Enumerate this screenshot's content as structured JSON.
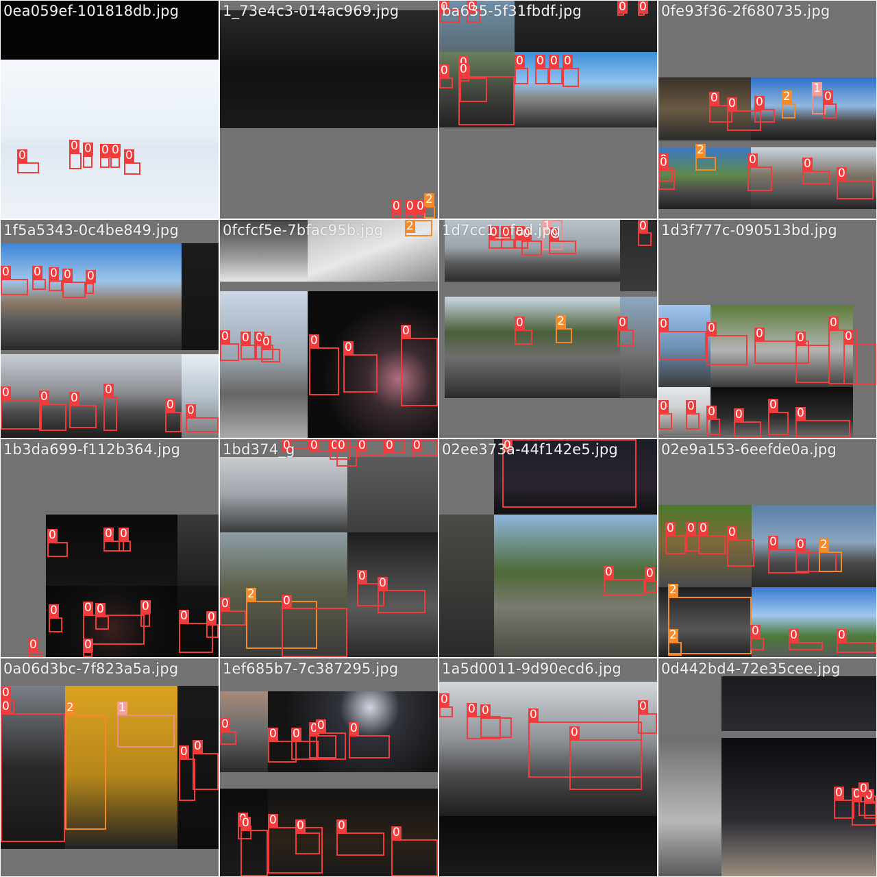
{
  "mosaic": {
    "tiles": [
      {
        "title": "0ea059ef-101818db.jpg",
        "regions": [
          {
            "bg": "#050505"
          },
          {
            "bg": "linear-gradient(180deg,#f4f8fc 0%,#e9f0f8 45%,#dfe8f2 55%,#eef3f8 100%)"
          }
        ],
        "dets": [
          {
            "cls": "0",
            "rect": {}
          },
          {
            "cls": "0",
            "rect": {}
          },
          {
            "cls": "0",
            "rect": {}
          },
          {
            "cls": "0",
            "rect": {}
          },
          {
            "cls": "0",
            "rect": {}
          },
          {
            "cls": "0",
            "rect": {}
          }
        ]
      },
      {
        "title": "1_73e4c3-014ac969.jpg",
        "regions": [
          {
            "bg": "linear-gradient(180deg,#2a2a2a 0%,#111 50%,#1a1a1a 100%)"
          }
        ],
        "dets": [
          {
            "cls": "0"
          },
          {
            "cls": "0"
          },
          {
            "cls": "0"
          },
          {
            "cls": "2"
          }
        ]
      },
      {
        "title": "ba635-5f31fbdf.jpg",
        "regions": [
          {
            "bg": "linear-gradient(180deg,#6f8ea8 0%,#5a6b75 100%)"
          },
          {
            "bg": "linear-gradient(180deg,#2a2a2a,#1c1c1c)"
          },
          {
            "bg": "linear-gradient(180deg,#6a7f5d 0%,#3c3f3a 60%,#222 100%)"
          },
          {
            "bg": "linear-gradient(180deg,#3f8fd8 0%,#8fc2ef 40%,#8a8a8a 60%,#2a2a2a 100%)"
          }
        ],
        "dets": [
          {
            "cls": "0"
          },
          {
            "cls": "0"
          },
          {
            "cls": "0"
          },
          {
            "cls": "0"
          },
          {
            "cls": "0"
          },
          {
            "cls": "0"
          },
          {
            "cls": "0"
          },
          {
            "cls": "0"
          },
          {
            "cls": "0"
          },
          {
            "cls": "0"
          },
          {
            "cls": "0"
          },
          {
            "cls": "0"
          }
        ]
      },
      {
        "title": "0fe93f36-2f680735.jpg",
        "regions": [
          {
            "bg": "linear-gradient(180deg,#3b3128 0%,#6a5a44 50%,#2b2b2b 100%)"
          },
          {
            "bg": "linear-gradient(180deg,#2f6fc9 0%,#8fb7dd 45%,#4a4a4a 70%,#1c1c1c 100%)"
          },
          {
            "bg": "linear-gradient(180deg,#3a78c8 0%,#5f8a4a 45%,#4d4d4d 70%,#1f1f1f 100%)"
          },
          {
            "bg": "linear-gradient(180deg,#c9d6e3 0%,#7d7466 45%,#5b5b5b 70%,#222 100%)"
          }
        ],
        "dets": [
          {
            "cls": "0"
          },
          {
            "cls": "0"
          },
          {
            "cls": "0"
          },
          {
            "cls": "2"
          },
          {
            "cls": "1"
          },
          {
            "cls": "0"
          },
          {
            "cls": "0"
          },
          {
            "cls": "0"
          },
          {
            "cls": "2"
          },
          {
            "cls": "0"
          },
          {
            "cls": "0"
          },
          {
            "cls": "0"
          }
        ]
      },
      {
        "title": "1f5a5343-0c4be849.jpg",
        "regions": [
          {
            "bg": "linear-gradient(180deg,#3c86d6 0%,#9ec5ea 35%,#8c7a68 55%,#555 75%,#2a2a2a 100%)"
          },
          {
            "bg": "linear-gradient(180deg,#1b1b1b,#141414)"
          },
          {
            "bg": "linear-gradient(180deg,#c9ced6 0%,#8d8f94 45%,#4a4a4a 70%,#1c1c1c 100%)"
          },
          {
            "bg": "linear-gradient(180deg,#e8eef5 0%,#b7c3cf 50%,#777 100%)"
          }
        ],
        "dets": [
          {
            "cls": "0"
          },
          {
            "cls": "0"
          },
          {
            "cls": "0"
          },
          {
            "cls": "0"
          },
          {
            "cls": "0"
          },
          {
            "cls": "0"
          },
          {
            "cls": "0"
          },
          {
            "cls": "0"
          },
          {
            "cls": "0"
          },
          {
            "cls": "0"
          },
          {
            "cls": "0"
          }
        ]
      },
      {
        "title": "0fcfcf5e-7bfac95b.jpg",
        "regions": [
          {
            "bg": "linear-gradient(180deg,#444 0%,#9a9a9a 60%,#e6e6e6 100%)"
          },
          {
            "bg": "linear-gradient(160deg,#b9b9b9 0%,#e8e8e8 50%,#8c8c8c 100%)"
          },
          {
            "bg": "linear-gradient(180deg,#c9d7e6 0%,#9aa7b2 45%,#666 70%,#aaa 100%)"
          },
          {
            "bg": "radial-gradient(circle at 70% 60%,#b07080 0%,#3a2a2e 25%,#0c0c0c 60%)"
          }
        ],
        "dets": [
          {
            "cls": "0"
          },
          {
            "cls": "0"
          },
          {
            "cls": "0"
          },
          {
            "cls": "0"
          },
          {
            "cls": "0"
          },
          {
            "cls": "0"
          },
          {
            "cls": "0"
          },
          {
            "cls": "2"
          }
        ]
      },
      {
        "title": "1d7cc1__fad.jpg",
        "regions": [
          {
            "bg": "linear-gradient(180deg,#b9c3cc 0%,#9aa3a8 45%,#5a5a5a 70%,#2c2c2c 100%)"
          },
          {
            "bg": "linear-gradient(180deg,#2a2a2a,#3a3a3a)"
          },
          {
            "bg": "linear-gradient(180deg,#c9d7e2 0%,#4b5f3a 35%,#6e6e6e 60%,#2c2c2c 100%)"
          },
          {
            "bg": "linear-gradient(180deg,#8da8c2 0%,#6e6e6e 60%,#3a3a3a 100%)"
          }
        ],
        "dets": [
          {
            "cls": "0"
          },
          {
            "cls": "0"
          },
          {
            "cls": "0"
          },
          {
            "cls": "0"
          },
          {
            "cls": "1"
          },
          {
            "cls": "0"
          },
          {
            "cls": "0"
          },
          {
            "cls": "2"
          },
          {
            "cls": "0"
          },
          {
            "cls": "0"
          }
        ]
      },
      {
        "title": "1d3f777c-090513bd.jpg",
        "regions": [
          {
            "bg": "linear-gradient(180deg,#9fc5ef 0%,#6f93b8 50%,#3a3a3a 100%)"
          },
          {
            "bg": "linear-gradient(180deg,#5e7d3a 0%,#b3b3b3 55%,#3b3b3b 100%)"
          },
          {
            "bg": "linear-gradient(180deg,#e3e9ef 0%,#cfcfcf 40%,#6a6a6a 100%)"
          },
          {
            "bg": "linear-gradient(180deg,#0d0d0d 0%,#2d2d2d 60%,#6c6c6c 100%)"
          }
        ],
        "dets": [
          {
            "cls": "0"
          },
          {
            "cls": "0"
          },
          {
            "cls": "0"
          },
          {
            "cls": "0"
          },
          {
            "cls": "0"
          },
          {
            "cls": "0"
          },
          {
            "cls": "0"
          },
          {
            "cls": "0"
          },
          {
            "cls": "0"
          },
          {
            "cls": "0"
          },
          {
            "cls": "0"
          },
          {
            "cls": "0"
          }
        ]
      },
      {
        "title": "1b3da699-f112b364.jpg",
        "regions": [
          {
            "bg": "linear-gradient(180deg,#0a0a0a,#151515)"
          },
          {
            "bg": "linear-gradient(180deg,#3a3a3a,#1e1e1e)"
          },
          {
            "bg": "radial-gradient(circle at 50% 60%,#3a2020 0%,#101010 45%,#080808 100%)"
          },
          {
            "bg": "linear-gradient(180deg,#141414,#0a0a0a)"
          }
        ],
        "dets": [
          {
            "cls": "0"
          },
          {
            "cls": "0"
          },
          {
            "cls": "0"
          },
          {
            "cls": "0"
          },
          {
            "cls": "0"
          },
          {
            "cls": "0"
          },
          {
            "cls": "0"
          },
          {
            "cls": "0"
          },
          {
            "cls": "0"
          },
          {
            "cls": "0"
          },
          {
            "cls": "0"
          }
        ]
      },
      {
        "title": "1bd374_g",
        "regions": [
          {
            "bg": "linear-gradient(180deg,#c8ccd0 0%,#9ea5ab 50%,#3a3a3a 100%)"
          },
          {
            "bg": "linear-gradient(180deg,#5b5b5b 0%,#3e3e3e 100%)"
          },
          {
            "bg": "linear-gradient(180deg,#8d9ea8 0%,#5c6048 45%,#3a3a3a 100%)"
          },
          {
            "bg": "linear-gradient(180deg,#1e1e1e 0%,#5a5a5a 60%,#2a2a2a 100%)"
          }
        ],
        "dets": [
          {
            "cls": "0"
          },
          {
            "cls": "0"
          },
          {
            "cls": "0"
          },
          {
            "cls": "0"
          },
          {
            "cls": "0"
          },
          {
            "cls": "0"
          },
          {
            "cls": "0"
          },
          {
            "cls": "2"
          },
          {
            "cls": "0"
          },
          {
            "cls": "0"
          },
          {
            "cls": "0"
          },
          {
            "cls": "0"
          }
        ]
      },
      {
        "title": "02ee373a-44f142e5.jpg",
        "regions": [
          {
            "bg": "linear-gradient(180deg,#1c1f28 0%,#2b2430 60%,#101010 100%)"
          },
          {
            "bg": "linear-gradient(180deg,#4c4a44 0%,#2a2a2a 100%)"
          },
          {
            "bg": "linear-gradient(180deg,#8fb6de 0%,#4d6b36 40%,#7a7a70 65%,#4a4a44 100%)"
          }
        ],
        "dets": [
          {
            "cls": "0"
          },
          {
            "cls": "0"
          },
          {
            "cls": "0"
          }
        ]
      },
      {
        "title": "02e9a153-6eefde0a.jpg",
        "regions": [
          {
            "bg": "linear-gradient(180deg,#4a7a2a 0%,#7d6a3a 45%,#4a4a4a 100%)"
          },
          {
            "bg": "linear-gradient(180deg,#5b7fa8 0%,#8aa5bf 45%,#4a4a4a 70%,#2a2a2a 100%)"
          },
          {
            "bg": "linear-gradient(180deg,#1f1f1f 0%,#555 60%,#222 100%)"
          },
          {
            "bg": "linear-gradient(180deg,#3a7ad0 0%,#9ec7ef 40%,#4d7a3a 70%,#5a5a5a 100%)"
          }
        ],
        "dets": [
          {
            "cls": "0"
          },
          {
            "cls": "0"
          },
          {
            "cls": "0"
          },
          {
            "cls": "0"
          },
          {
            "cls": "0"
          },
          {
            "cls": "0"
          },
          {
            "cls": "2"
          },
          {
            "cls": "2"
          },
          {
            "cls": "2"
          },
          {
            "cls": "0"
          },
          {
            "cls": "0"
          },
          {
            "cls": "0"
          }
        ]
      },
      {
        "title": "0a06d3bc-7f823a5a.jpg",
        "regions": [
          {
            "bg": "linear-gradient(180deg,#7a7f86 0%,#2a2a2a 50%,#151515 100%)"
          },
          {
            "bg": "linear-gradient(180deg,#d9a322 0%,#b7861a 55%,#222 100%)"
          },
          {
            "bg": "linear-gradient(180deg,#1a1a1a,#0d0d0d)"
          }
        ],
        "dets": [
          {
            "cls": "0"
          },
          {
            "cls": "2"
          },
          {
            "cls": "1"
          },
          {
            "cls": "0"
          },
          {
            "cls": "0"
          },
          {
            "cls": "0"
          }
        ]
      },
      {
        "title": "1ef685b7-7c387295.jpg",
        "regions": [
          {
            "bg": "linear-gradient(180deg,#a88a78 0%,#6e6e6e 45%,#2a2a2a 100%)"
          },
          {
            "bg": "radial-gradient(circle at 60% 20%,#d0d6e0 0%,#30323a 25%,#141414 70%)"
          },
          {
            "bg": "linear-gradient(180deg,#0c0c0c,#1a1a1a)"
          },
          {
            "bg": "linear-gradient(180deg,#121212 0%,#2b2218 60%,#1a1a1a 100%)"
          }
        ],
        "dets": [
          {
            "cls": "0"
          },
          {
            "cls": "0"
          },
          {
            "cls": "0"
          },
          {
            "cls": "0"
          },
          {
            "cls": "0"
          },
          {
            "cls": "0"
          },
          {
            "cls": "0"
          },
          {
            "cls": "0"
          },
          {
            "cls": "0"
          },
          {
            "cls": "0"
          },
          {
            "cls": "0"
          },
          {
            "cls": "0"
          }
        ]
      },
      {
        "title": "1a5d0011-9d90ecd6.jpg",
        "regions": [
          {
            "bg": "linear-gradient(180deg,#d3d7dc 0%,#8a8f94 45%,#4a4a4a 70%,#1e1e1e 100%)"
          },
          {
            "bg": "linear-gradient(180deg,#0a0a0a,#1a1a1a)"
          }
        ],
        "dets": [
          {
            "cls": "0"
          },
          {
            "cls": "0"
          },
          {
            "cls": "0"
          },
          {
            "cls": "0"
          },
          {
            "cls": "0"
          },
          {
            "cls": "0"
          }
        ]
      },
      {
        "title": "0d442bd4-72e35cee.jpg",
        "regions": [
          {
            "bg": "linear-gradient(180deg,#1b1b1f 0%,#2b2b30 100%)"
          },
          {
            "bg": "linear-gradient(180deg,#6f6f6f 0%,#b8b8b8 60%,#5a5a5a 100%)"
          },
          {
            "bg": "linear-gradient(180deg,#0c0c10 0%,#2d2d33 60%,#9a8f80 100%)"
          }
        ],
        "dets": [
          {
            "cls": "0"
          },
          {
            "cls": "0"
          },
          {
            "cls": "0"
          },
          {
            "cls": "0"
          }
        ]
      }
    ]
  },
  "class_colors": {
    "0": "#f03c3c",
    "1": "#f5a0a0",
    "2": "#f58a2a"
  }
}
